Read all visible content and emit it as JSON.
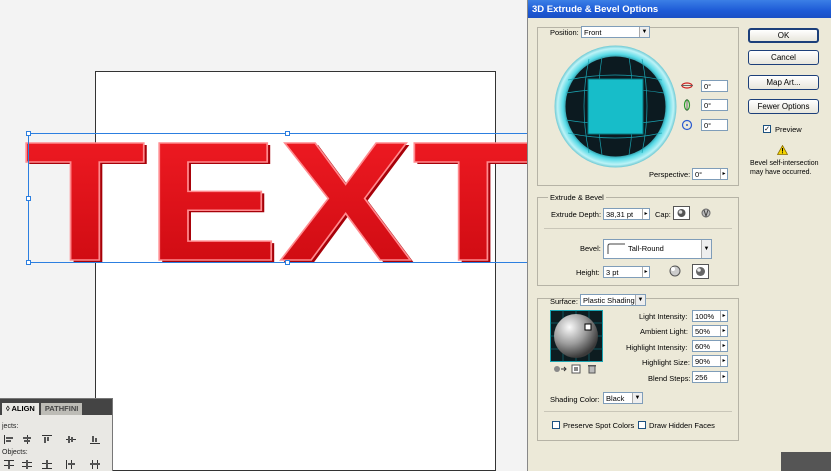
{
  "dialog": {
    "title": "3D Extrude & Bevel Options",
    "position": {
      "label": "Position:",
      "value": "Front"
    },
    "rotation": {
      "x": "0°",
      "y": "0°",
      "z": "0°"
    },
    "perspective": {
      "label": "Perspective:",
      "value": "0°"
    },
    "extrude_bevel": {
      "section_label": "Extrude & Bevel",
      "depth_label": "Extrude Depth:",
      "depth_value": "38,31 pt",
      "cap_label": "Cap:",
      "bevel_label": "Bevel:",
      "bevel_value": "Tall-Round",
      "height_label": "Height:",
      "height_value": "3 pt"
    },
    "surface": {
      "label": "Surface:",
      "value": "Plastic Shading",
      "light_intensity_label": "Light Intensity:",
      "light_intensity": "100%",
      "ambient_light_label": "Ambient Light:",
      "ambient_light": "50%",
      "highlight_intensity_label": "Highlight Intensity:",
      "highlight_intensity": "60%",
      "highlight_size_label": "Highlight Size:",
      "highlight_size": "90%",
      "blend_steps_label": "Blend Steps:",
      "blend_steps": "256",
      "shading_color_label": "Shading Color:",
      "shading_color": "Black"
    },
    "preserve_spot_label": "Preserve Spot Colors",
    "draw_hidden_label": "Draw Hidden Faces",
    "buttons": {
      "ok": "OK",
      "cancel": "Cancel",
      "map_art": "Map Art...",
      "fewer_options": "Fewer Options"
    },
    "preview_label": "Preview",
    "warning": "Bevel self-intersection may have occurred."
  },
  "canvas": {
    "art_text": "TEXT"
  },
  "align_panel": {
    "tab_align": "ALIGN",
    "tab_pathfinder": "PATHFINI",
    "label_objects_1": "jects:",
    "label_objects_2": "Objects:"
  },
  "colors": {
    "text_red": "#e8131b",
    "selection": "#2c7fe0",
    "orb": "#15c7d4"
  },
  "icons": [
    "rotate-x-icon",
    "rotate-y-icon",
    "rotate-z-icon",
    "cap-on-icon",
    "cap-off-icon",
    "bevel-in-icon",
    "bevel-out-icon",
    "warning-icon",
    "new-light-icon"
  ]
}
